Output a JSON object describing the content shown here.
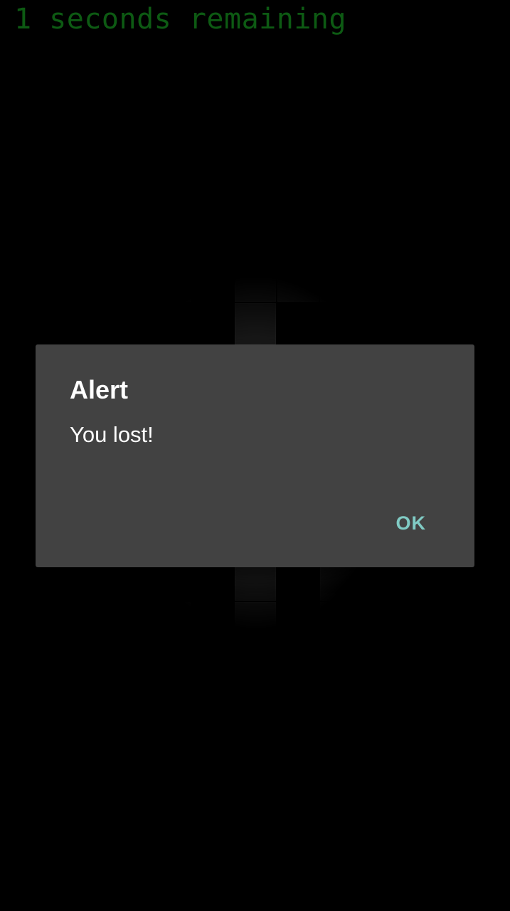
{
  "timer": {
    "text": "1 seconds remaining",
    "color": "#0d5a13"
  },
  "dialog": {
    "title": "Alert",
    "message": "You lost!",
    "ok_label": "OK",
    "background": "#424242",
    "accent": "#80cbc4"
  },
  "board": {
    "tile_color": "#1e1e1e"
  }
}
